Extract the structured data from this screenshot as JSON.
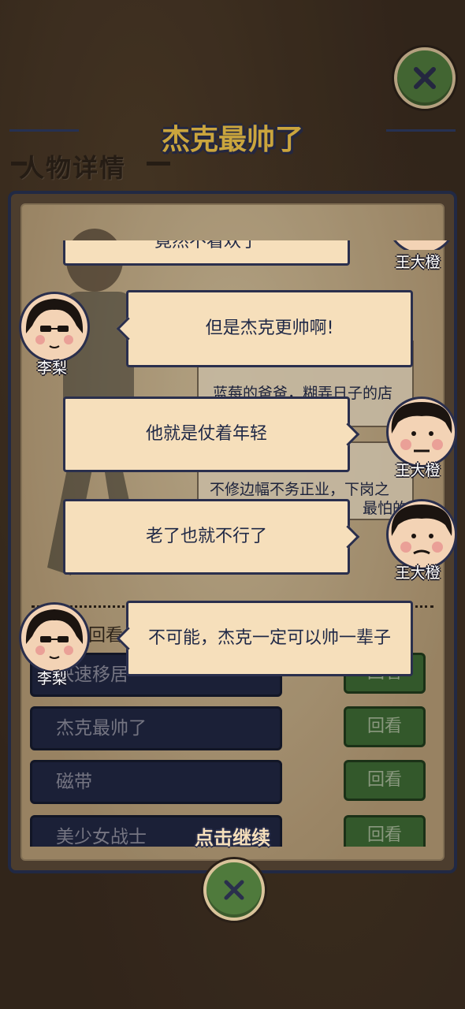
{
  "page_title": "杰克最帅了",
  "section_label": "人物详情",
  "info_lines": {
    "line1": "蓝莓的爸爸，糊弄日子的店",
    "line2": "不修边幅不务正业，下岗之",
    "line3": "最怕的"
  },
  "list_rows": [
    {
      "name": "快速移居",
      "button": "回看"
    },
    {
      "name": "杰克最帅了",
      "button": "回看"
    },
    {
      "name": "磁带",
      "button": "回看"
    },
    {
      "name": "美少女战士",
      "button": "回看"
    }
  ],
  "list_header_partial": "回看",
  "dialogue": [
    {
      "speaker": "王大橙",
      "text": "竟然不看欢了"
    },
    {
      "speaker": "李梨",
      "text": "但是杰克更帅啊!"
    },
    {
      "speaker": "王大橙",
      "text": "他就是仗着年轻"
    },
    {
      "speaker": "王大橙",
      "text": "老了也就不行了"
    },
    {
      "speaker": "李梨",
      "text": "不可能，杰克一定可以帅一辈子"
    }
  ],
  "continue_label": "点击继续",
  "colors": {
    "title": "#f4c84a",
    "bubble": "#f6dfbb",
    "outline": "#2a2f4d",
    "button_green": "#4f7a3c"
  },
  "icons": {
    "close": "close-x-icon"
  }
}
